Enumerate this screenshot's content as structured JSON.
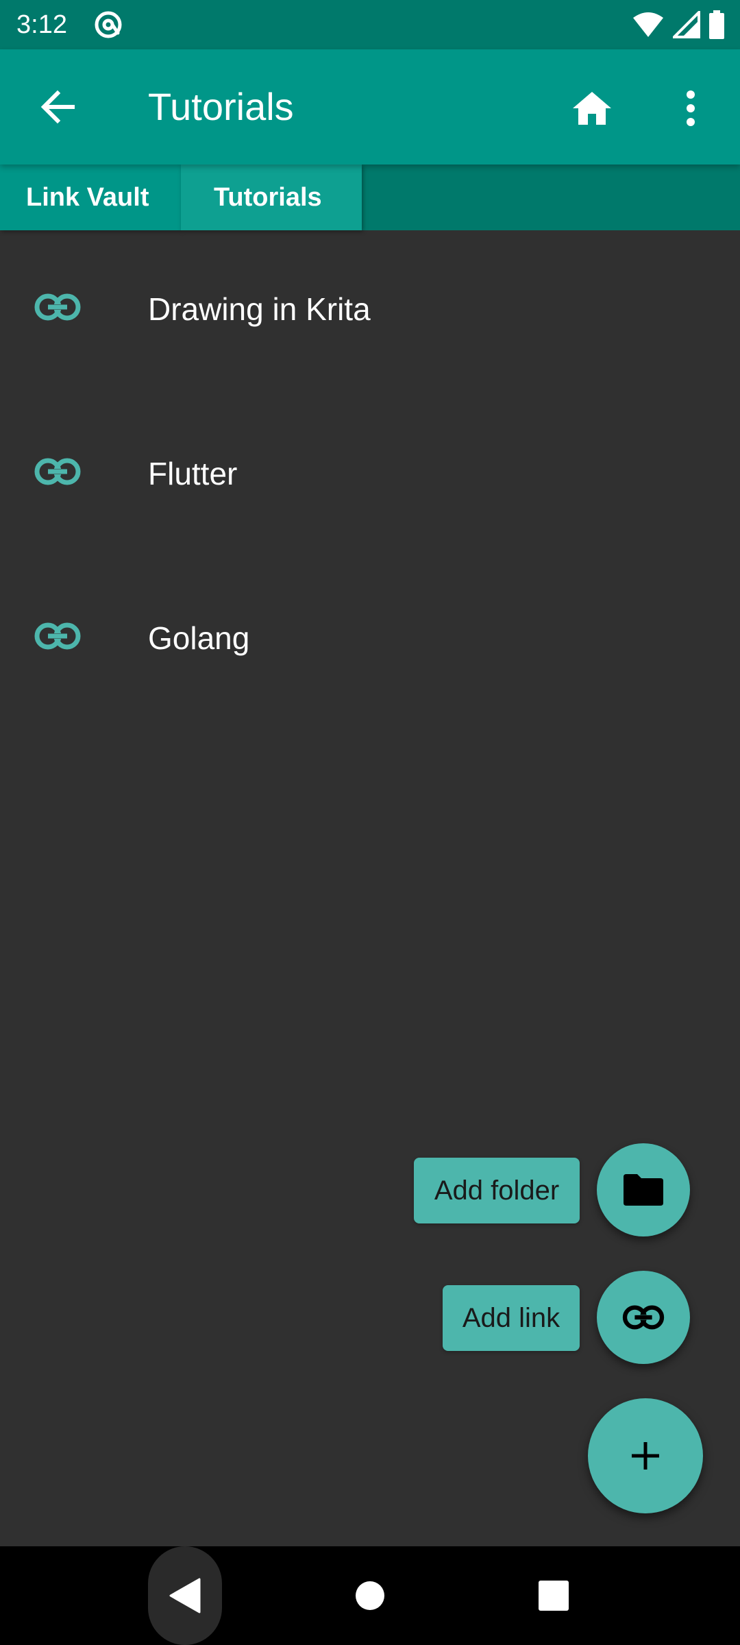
{
  "status_bar": {
    "time": "3:12",
    "icons": [
      "at-sign-icon",
      "wifi-icon",
      "signal-icon",
      "battery-icon"
    ]
  },
  "app_bar": {
    "title": "Tutorials",
    "back_icon": "arrow-back-icon",
    "home_icon": "home-icon",
    "more_icon": "more-vert-icon"
  },
  "breadcrumb": {
    "items": [
      {
        "label": "Link Vault"
      },
      {
        "label": "Tutorials"
      }
    ]
  },
  "list": {
    "items": [
      {
        "label": "Drawing in Krita",
        "icon": "link-icon"
      },
      {
        "label": "Flutter",
        "icon": "link-icon"
      },
      {
        "label": "Golang",
        "icon": "link-icon"
      }
    ]
  },
  "speed_dial": {
    "add_folder_label": "Add folder",
    "add_link_label": "Add link",
    "folder_icon": "folder-icon",
    "link_icon": "link-icon",
    "main_icon": "plus-icon"
  },
  "colors": {
    "status_bar": "#00796b",
    "app_bar": "#009688",
    "accent": "#4db6ac",
    "background": "#303030"
  },
  "nav_bar": {
    "icons": [
      "nav-back-icon",
      "nav-home-icon",
      "nav-recents-icon"
    ]
  }
}
